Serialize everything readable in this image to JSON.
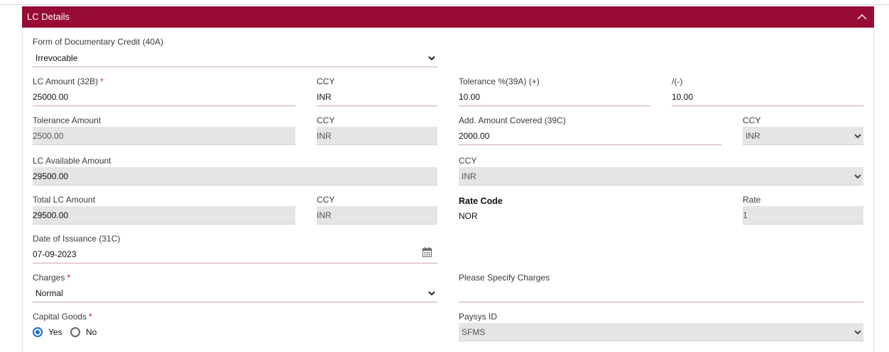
{
  "section": {
    "title": "LC Details"
  },
  "form_of_credit": {
    "label": "Form of Documentary Credit (40A)",
    "value": "Irrevocable"
  },
  "lc_amount": {
    "label": "LC Amount (32B)",
    "required": "*",
    "value": "25000.00"
  },
  "lc_amount_ccy": {
    "label": "CCY",
    "value": "INR"
  },
  "tolerance_plus": {
    "label": "Tolerance %(39A) (+)",
    "value": "10.00"
  },
  "tolerance_minus": {
    "label": "/(-)",
    "value": "10.00"
  },
  "tolerance_amount": {
    "label": "Tolerance Amount",
    "value": "2500.00"
  },
  "tolerance_amount_ccy": {
    "label": "CCY",
    "value": "INR"
  },
  "add_amount": {
    "label": "Add. Amount Covered (39C)",
    "value": "2000.00"
  },
  "add_amount_ccy": {
    "label": "CCY",
    "value": "INR"
  },
  "lc_available_amount": {
    "label": "LC Available Amount",
    "value": "29500.00"
  },
  "lc_available_ccy": {
    "label": "CCY",
    "value": "INR"
  },
  "total_lc_amount": {
    "label": "Total LC Amount",
    "value": "29500.00"
  },
  "total_lc_ccy": {
    "label": "CCY",
    "value": "INR"
  },
  "rate_code": {
    "label": "Rate Code",
    "value": "NOR"
  },
  "rate": {
    "label": "Rate",
    "value": "1"
  },
  "date_of_issuance": {
    "label": "Date of Issuance (31C)",
    "value": "07-09-2023"
  },
  "charges": {
    "label": "Charges",
    "required": "*",
    "value": "Normal"
  },
  "specify_charges": {
    "label": "Please Specify Charges",
    "value": ""
  },
  "capital_goods": {
    "label": "Capital Goods",
    "required": "*",
    "options": [
      "Yes",
      "No"
    ],
    "selected": "Yes"
  },
  "paysys_id": {
    "label": "Paysys ID",
    "value": "SFMS"
  },
  "colors": {
    "header_bg": "#970b35",
    "accent_radio": "#1a6fc9",
    "required_star": "#c0123d"
  },
  "icons": {
    "collapse": "chevron-up-icon",
    "dropdown": "chevron-down-icon",
    "calendar": "calendar-icon"
  }
}
